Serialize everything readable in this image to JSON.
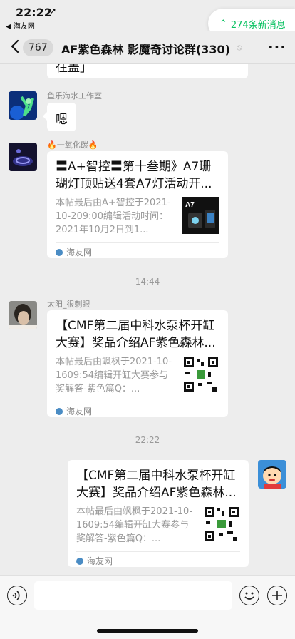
{
  "status_bar": {
    "time": "22:22",
    "location_arrow": "➚",
    "back_app": "◀ 海友网"
  },
  "new_messages": {
    "arrow": "⌃",
    "label": "274条新消息"
  },
  "nav": {
    "count": "767",
    "title": "AF紫色森林 影魔奇讨论群(330)",
    "mute": "⦸",
    "more": "···"
  },
  "messages": {
    "partial_prev": {
      "text": "往盖」"
    },
    "msg1": {
      "sender": "鱼乐海水工作室",
      "text": "嗯"
    },
    "msg2": {
      "sender": "🔥一氧化碳🔥",
      "title": "〓A+智控〓第十叁期》A7珊瑚灯顶贴送4套A7灯活动开...",
      "desc": "本帖最后由A+智控于2021-10-209:00编辑活动时间：2021年10月2日到1...",
      "thumb_label": "A7",
      "source": "海友网"
    },
    "stamp1": "14:44",
    "msg3": {
      "sender": "太阳_很刺眼",
      "title": "【CMF第二届中科水泵杯开缸大赛】奖品介绍AF紫色森林...",
      "desc": "本帖最后由飒枫于2021-10-1609:54编辑开缸大赛参与奖解答-紫色篇Q：...",
      "source": "海友网"
    },
    "stamp2": "22:22",
    "msg4": {
      "title": "【CMF第二届中科水泵杯开缸大赛】奖品介绍AF紫色森林...",
      "desc": "本帖最后由飒枫于2021-10-1609:54编辑开缸大赛参与奖解答-紫色篇Q：...",
      "source": "海友网"
    }
  },
  "colors": {
    "accent": "#07c160",
    "background": "#ededed",
    "bubble": "#ffffff",
    "meta_text": "#999999"
  }
}
